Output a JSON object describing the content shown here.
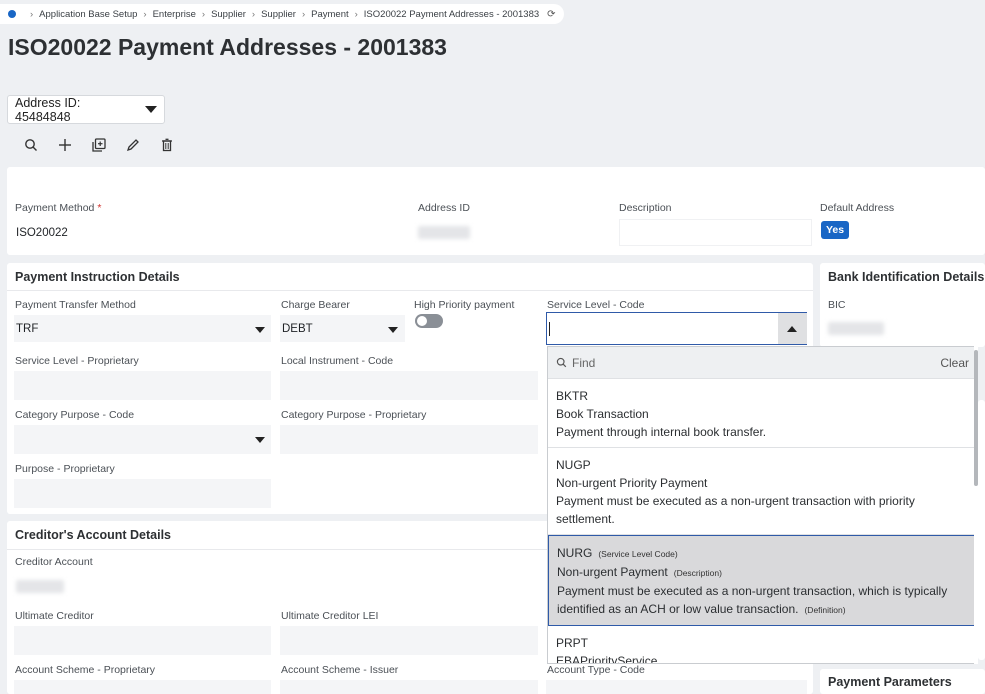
{
  "breadcrumb": [
    "Application Base Setup",
    "Enterprise",
    "Supplier",
    "Supplier",
    "Payment",
    "ISO20022 Payment Addresses - 2001383"
  ],
  "page_title": "ISO20022 Payment Addresses - 2001383",
  "record_selector": "Address ID: 45484848",
  "toolbar_icons": [
    "search-icon",
    "add-icon",
    "duplicate-icon",
    "edit-icon",
    "delete-icon"
  ],
  "header": {
    "payment_method_label": "Payment Method",
    "required_mark": "*",
    "payment_method_value": "ISO20022",
    "address_id_label": "Address ID",
    "description_label": "Description",
    "default_address_label": "Default Address",
    "default_address_value": "Yes"
  },
  "instruction": {
    "title": "Payment Instruction Details",
    "transfer_method_label": "Payment Transfer Method",
    "transfer_method_value": "TRF",
    "charge_bearer_label": "Charge Bearer",
    "charge_bearer_value": "DEBT",
    "high_priority_label": "High Priority payment",
    "service_level_code_label": "Service Level - Code",
    "service_level_prop_label": "Service Level - Proprietary",
    "local_instrument_label": "Local Instrument - Code",
    "category_purpose_code_label": "Category Purpose - Code",
    "category_purpose_prop_label": "Category Purpose - Proprietary",
    "purpose_prop_label": "Purpose - Proprietary"
  },
  "bank": {
    "title": "Bank Identification Details",
    "bic_label": "BIC"
  },
  "creditor": {
    "title": "Creditor's Account Details",
    "creditor_account_label": "Creditor Account",
    "ultimate_creditor_label": "Ultimate Creditor",
    "ultimate_creditor_lei_label": "Ultimate Creditor LEI",
    "account_scheme_prop_label": "Account Scheme - Proprietary",
    "account_scheme_issuer_label": "Account Scheme - Issuer",
    "account_type_code_label": "Account Type - Code"
  },
  "payment_parameters_title": "Payment Parameters",
  "dropdown": {
    "find_placeholder": "Find",
    "clear_label": "Clear",
    "options": [
      {
        "code": "BKTR",
        "description": "Book Transaction",
        "definition": "Payment through internal book transfer."
      },
      {
        "code": "NUGP",
        "description": "Non-urgent Priority Payment",
        "definition": "Payment must be executed as a non-urgent transaction with priority settlement."
      },
      {
        "code": "NURG",
        "code_hint": "(Service Level Code)",
        "description": "Non-urgent Payment",
        "description_hint": "(Description)",
        "definition": "Payment must be executed as a non-urgent transaction, which is typically identified as an ACH or low value transaction.",
        "definition_hint": "(Definition)"
      },
      {
        "code": "PRPT",
        "description": "EBAPriorityService"
      }
    ]
  },
  "colors": {
    "accent": "#1966c5",
    "selected_border": "#2f5aa8",
    "required": "#d0312d"
  }
}
